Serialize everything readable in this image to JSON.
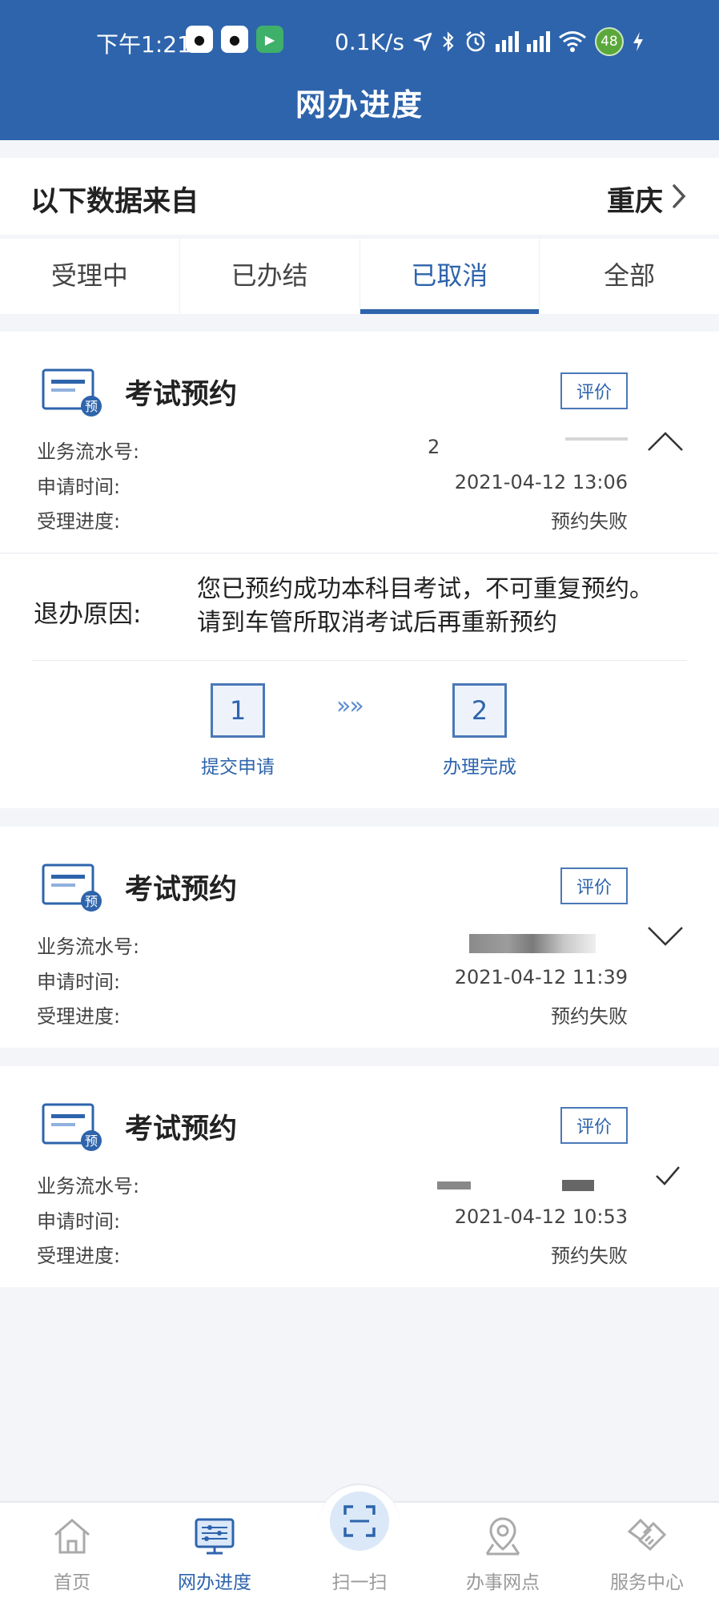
{
  "status_bar": {
    "time": "下午1:21",
    "net_speed": "0.1K/s",
    "battery": "48",
    "network_sub": "6"
  },
  "header": {
    "title": "网办进度"
  },
  "region": {
    "label": "以下数据来自",
    "city": "重庆"
  },
  "tabs": [
    {
      "label": "受理中"
    },
    {
      "label": "已办结"
    },
    {
      "label": "已取消"
    },
    {
      "label": "全部"
    }
  ],
  "active_tab_index": 2,
  "field_labels": {
    "serial": "业务流水号:",
    "time": "申请时间:",
    "progress": "受理进度:"
  },
  "records": [
    {
      "badge": "预",
      "title": "考试预约",
      "rate_label": "评价",
      "serial_visible": "2",
      "time": "2021-04-12 13:06",
      "progress": "预约失败",
      "expanded": true
    },
    {
      "badge": "预",
      "title": "考试预约",
      "rate_label": "评价",
      "time": "2021-04-12 11:39",
      "progress": "预约失败",
      "expanded": false
    },
    {
      "badge": "预",
      "title": "考试预约",
      "rate_label": "评价",
      "time": "2021-04-12 10:53",
      "progress": "预约失败",
      "expanded": false
    }
  ],
  "detail": {
    "reason_label": "退办原因:",
    "reason_line1": "您已预约成功本科目考试，不可重复预约。",
    "reason_line2": "请到车管所取消考试后再重新预约",
    "steps": [
      {
        "num": "1",
        "label": "提交申请"
      },
      {
        "num": "2",
        "label": "办理完成"
      }
    ],
    "arrows": "»»"
  },
  "bottom_nav": [
    {
      "label": "首页",
      "icon": "home-icon"
    },
    {
      "label": "网办进度",
      "icon": "monitor-icon"
    },
    {
      "label": "扫一扫",
      "icon": "scan-icon"
    },
    {
      "label": "办事网点",
      "icon": "location-pin-icon"
    },
    {
      "label": "服务中心",
      "icon": "service-icon"
    }
  ],
  "colors": {
    "brand": "#2e64ac",
    "background": "#f3f5f9",
    "muted": "#999999"
  }
}
